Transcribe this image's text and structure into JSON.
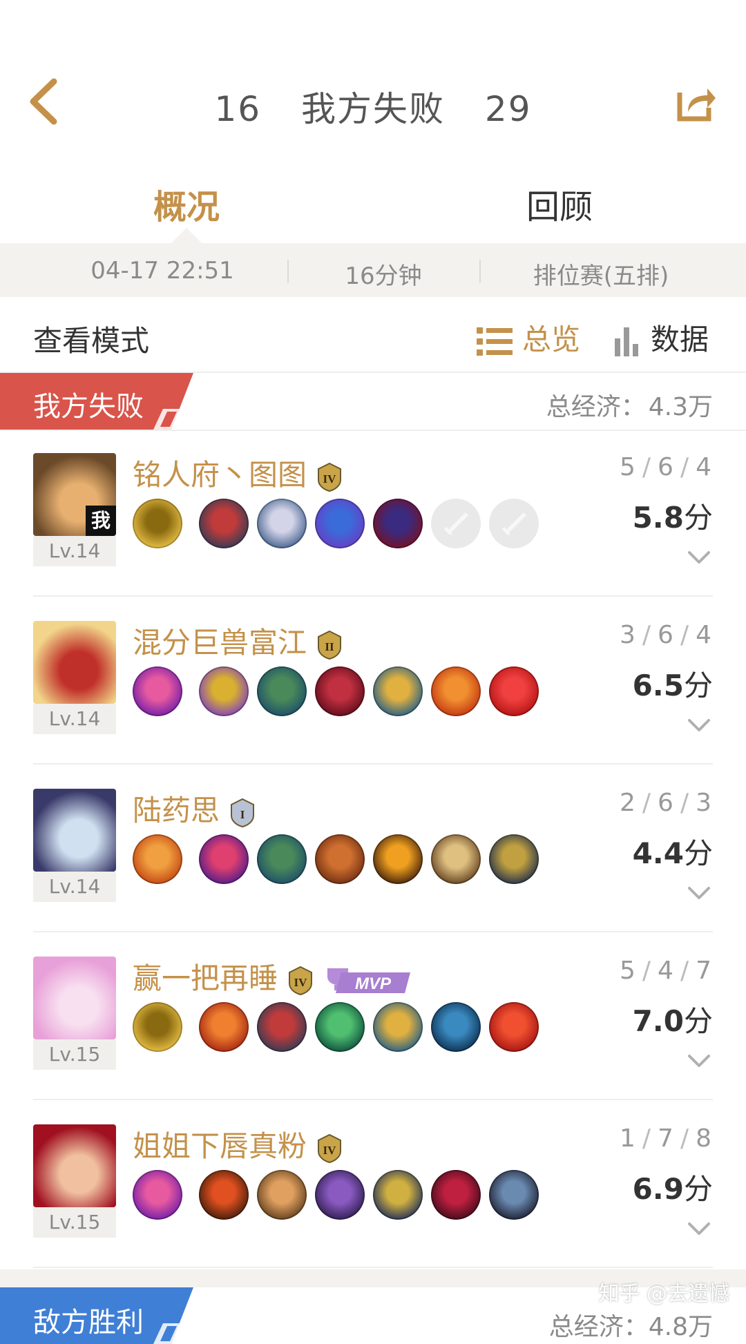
{
  "header": {
    "back_icon": "chevron-left-icon",
    "our_kills": "16",
    "result": "我方失败",
    "enemy_kills": "29",
    "share_icon": "share-icon"
  },
  "tabs": [
    {
      "label": "概况",
      "active": true
    },
    {
      "label": "回顾",
      "active": false
    }
  ],
  "info": {
    "datetime": "04-17 22:51",
    "duration": "16分钟",
    "mode": "排位赛(五排)"
  },
  "view_mode": {
    "label": "查看模式",
    "summary_label": "总览",
    "summary_icon": "list-icon",
    "data_label": "数据",
    "data_icon": "bar-chart-icon"
  },
  "team": {
    "label": "我方失败",
    "economy_label": "总经济：",
    "economy_value": "4.3万",
    "banner_color": "#d9544a"
  },
  "players": [
    {
      "name": "铭人府丶图图",
      "rank_badge": "IV",
      "level": "Lv.14",
      "is_me": true,
      "me_label": "我",
      "kills": "5",
      "deaths": "6",
      "assists": "4",
      "rating": "5.8",
      "rating_unit": "分",
      "items": [
        {
          "colors": [
            "#f2c94c",
            "#8a6a10"
          ]
        },
        {
          "colors": [
            "#2a3b55",
            "#c23b3b"
          ]
        },
        {
          "colors": [
            "#3c5c8a",
            "#d4d4e8"
          ]
        },
        {
          "colors": [
            "#6a3cc4",
            "#3b6ad9"
          ]
        },
        {
          "colors": [
            "#7a1020",
            "#3a2a80"
          ]
        },
        {
          "colors": [
            "#e6e6e6",
            "#d0d0d0"
          ],
          "empty": true
        },
        {
          "colors": [
            "#e6e6e6",
            "#d0d0d0"
          ],
          "empty": true
        }
      ],
      "avatar_colors": [
        "#6b4a2a",
        "#e8b070"
      ]
    },
    {
      "name": "混分巨兽富江",
      "rank_badge": "II",
      "level": "Lv.14",
      "is_me": false,
      "kills": "3",
      "deaths": "6",
      "assists": "4",
      "rating": "6.5",
      "rating_unit": "分",
      "items": [
        {
          "colors": [
            "#6a1aa8",
            "#e85aa0"
          ]
        },
        {
          "colors": [
            "#7a3cc4",
            "#d9b030"
          ]
        },
        {
          "colors": [
            "#1a4a6a",
            "#4a8a5a"
          ]
        },
        {
          "colors": [
            "#5a0a1a",
            "#c03040"
          ]
        },
        {
          "colors": [
            "#1a5a8a",
            "#e0b040"
          ]
        },
        {
          "colors": [
            "#c03010",
            "#f09030"
          ]
        },
        {
          "colors": [
            "#b01010",
            "#f04040"
          ]
        }
      ],
      "avatar_colors": [
        "#f2d58a",
        "#c0302a"
      ]
    },
    {
      "name": "陆药思",
      "rank_badge": "I",
      "level": "Lv.14",
      "is_me": false,
      "kills": "2",
      "deaths": "6",
      "assists": "3",
      "rating": "4.4",
      "rating_unit": "分",
      "items": [
        {
          "colors": [
            "#c04010",
            "#f0a040"
          ]
        },
        {
          "colors": [
            "#4a1a8a",
            "#e04070"
          ]
        },
        {
          "colors": [
            "#1a4a6a",
            "#4a8a5a"
          ]
        },
        {
          "colors": [
            "#6a2a10",
            "#d07030"
          ]
        },
        {
          "colors": [
            "#3a1a0a",
            "#f0a020"
          ]
        },
        {
          "colors": [
            "#5a3a1a",
            "#e0c080"
          ]
        },
        {
          "colors": [
            "#1a2a4a",
            "#c0a040"
          ]
        }
      ],
      "avatar_colors": [
        "#3a3a6a",
        "#d0e0f0"
      ]
    },
    {
      "name": "赢一把再睡",
      "rank_badge": "IV",
      "mvp": "MVP",
      "level": "Lv.15",
      "is_me": false,
      "kills": "5",
      "deaths": "4",
      "assists": "7",
      "rating": "7.0",
      "rating_unit": "分",
      "items": [
        {
          "colors": [
            "#f2c94c",
            "#8a6a10"
          ]
        },
        {
          "colors": [
            "#a02010",
            "#f08030"
          ]
        },
        {
          "colors": [
            "#2a3b55",
            "#c23b3b"
          ]
        },
        {
          "colors": [
            "#0a4a3a",
            "#50c070"
          ]
        },
        {
          "colors": [
            "#1a5a8a",
            "#e0b040"
          ]
        },
        {
          "colors": [
            "#0a2a4a",
            "#3a8ac0"
          ]
        },
        {
          "colors": [
            "#a01010",
            "#f05030"
          ]
        }
      ],
      "avatar_colors": [
        "#e8a0d8",
        "#f8e0f0"
      ]
    },
    {
      "name": "姐姐下唇真粉",
      "rank_badge": "IV",
      "level": "Lv.15",
      "is_me": false,
      "kills": "1",
      "deaths": "7",
      "assists": "8",
      "rating": "6.9",
      "rating_unit": "分",
      "items": [
        {
          "colors": [
            "#6a1aa8",
            "#e85aa0"
          ]
        },
        {
          "colors": [
            "#3a1a0a",
            "#e05020"
          ]
        },
        {
          "colors": [
            "#5a3a1a",
            "#e0a060"
          ]
        },
        {
          "colors": [
            "#2a1a4a",
            "#8a5ac0"
          ]
        },
        {
          "colors": [
            "#1a2a5a",
            "#d0b040"
          ]
        },
        {
          "colors": [
            "#3a0a1a",
            "#c02040"
          ]
        },
        {
          "colors": [
            "#1a1a2a",
            "#6a8ab0"
          ]
        }
      ],
      "avatar_colors": [
        "#a01020",
        "#f0c0a0"
      ]
    }
  ],
  "enemy": {
    "label": "敌方胜利",
    "economy_label": "总经济：",
    "economy_value": "4.8万",
    "banner_color": "#3f7fd6"
  },
  "watermark": "知乎 @去遗憾",
  "colors": {
    "accent": "#c4914a",
    "bg_gray": "#f3f2ef"
  }
}
